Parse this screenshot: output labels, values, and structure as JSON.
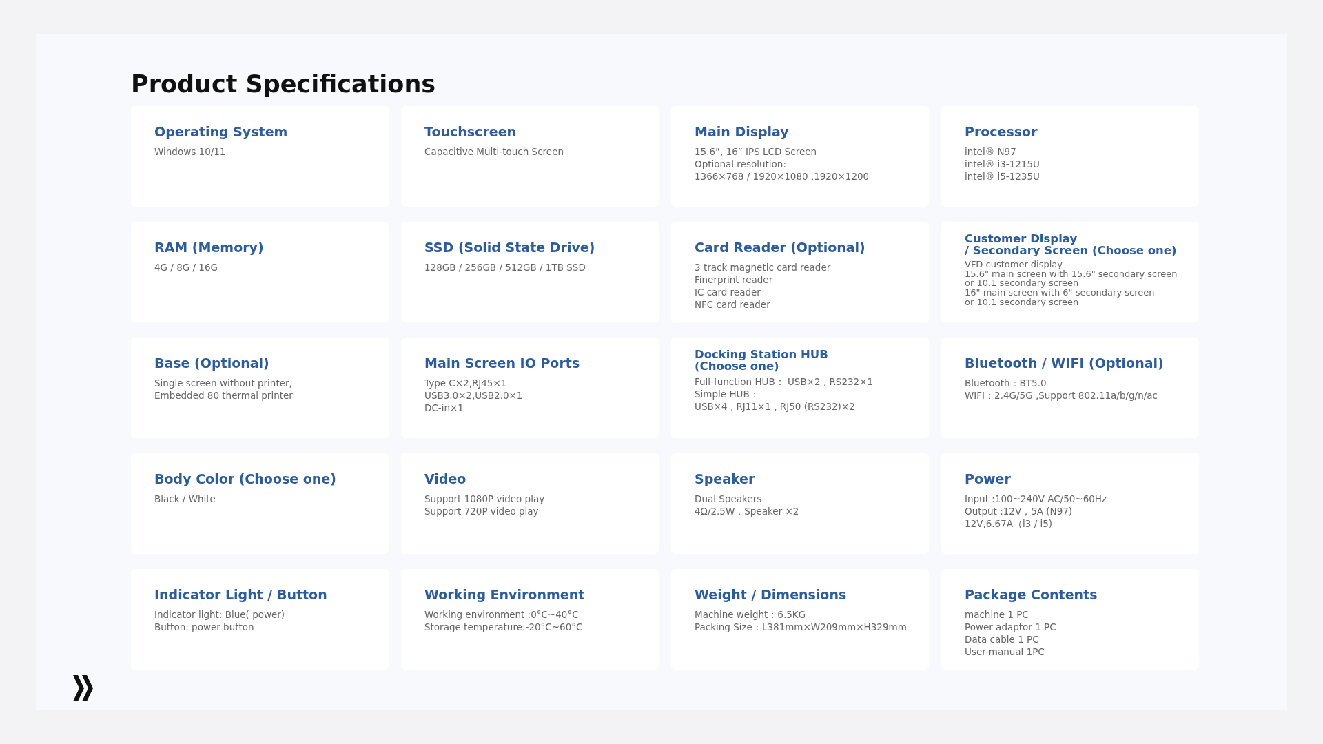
{
  "page_title": "Product Specifications",
  "specs": [
    {
      "heading": "Operating System",
      "lines": [
        "Windows 10/11"
      ]
    },
    {
      "heading": "Touchscreen",
      "lines": [
        "Capacitive Multi-touch Screen"
      ]
    },
    {
      "heading": "Main Display",
      "lines": [
        "15.6”, 16” IPS LCD Screen",
        "Optional resolution:",
        "1366×768 / 1920×1080 ,1920×1200"
      ]
    },
    {
      "heading": "Processor",
      "lines": [
        "intel® N97",
        "intel® i3-1215U",
        "intel® i5-1235U"
      ]
    },
    {
      "heading": "RAM (Memory)",
      "lines": [
        "4G / 8G / 16G"
      ]
    },
    {
      "heading": "SSD (Solid State Drive)",
      "lines": [
        "128GB / 256GB / 512GB / 1TB SSD"
      ]
    },
    {
      "heading": "Card Reader (Optional)",
      "lines": [
        "3 track magnetic card reader",
        "Finerprint reader",
        "IC card reader",
        "NFC card reader"
      ]
    },
    {
      "heading": "Customer Display\n/ Secondary Screen (Choose one)",
      "lines": [
        "VFD customer display",
        "15.6\" main screen with 15.6\" secondary screen",
        "or 10.1 secondary screen",
        "16\" main screen with 6\" secondary screen",
        "or 10.1 secondary screen"
      ]
    },
    {
      "heading": "Base (Optional)",
      "lines": [
        "Single screen without printer,",
        "Embedded 80 thermal printer"
      ]
    },
    {
      "heading": "Main Screen IO Ports",
      "lines": [
        "Type C×2,RJ45×1",
        "USB3.0×2,USB2.0×1",
        "DC-in×1"
      ]
    },
    {
      "heading": "Docking Station HUB\n(Choose one)",
      "lines": [
        "Full-function HUB： USB×2 , RS232×1",
        "Simple HUB：",
        "USB×4 , RJ11×1 , RJ50 (RS232)×2"
      ]
    },
    {
      "heading": "Bluetooth / WIFI (Optional)",
      "lines": [
        "Bluetooth：BT5.0",
        "WIFI：2.4G/5G ,Support 802.11a/b/g/n/ac"
      ]
    },
    {
      "heading": "Body Color (Choose one)",
      "lines": [
        "Black / White"
      ]
    },
    {
      "heading": "Video",
      "lines": [
        "Support 1080P video play",
        "Support 720P video play"
      ]
    },
    {
      "heading": "Speaker",
      "lines": [
        "Dual Speakers",
        "4Ω/2.5W，Speaker ×2"
      ]
    },
    {
      "heading": "Power",
      "lines": [
        "Input :100~240V AC/50~60Hz",
        "Output :12V，5A (N97)",
        "12V,6.67A（i3 / i5)"
      ]
    },
    {
      "heading": "Indicator Light / Button",
      "lines": [
        "Indicator light: Blue( power)",
        "Button: power button"
      ]
    },
    {
      "heading": "Working Environment",
      "lines": [
        "Working environment :0°C~40°C",
        "Storage temperature:-20°C~60°C"
      ]
    },
    {
      "heading": "Weight / Dimensions",
      "lines": [
        "Machine weight：6.5KG",
        "Packing Size：L381mm×W209mm×H329mm"
      ]
    },
    {
      "heading": "Package Contents",
      "lines": [
        "machine 1 PC",
        "Power adaptor 1 PC",
        "Data cable 1 PC",
        "User-manual 1PC"
      ]
    }
  ]
}
